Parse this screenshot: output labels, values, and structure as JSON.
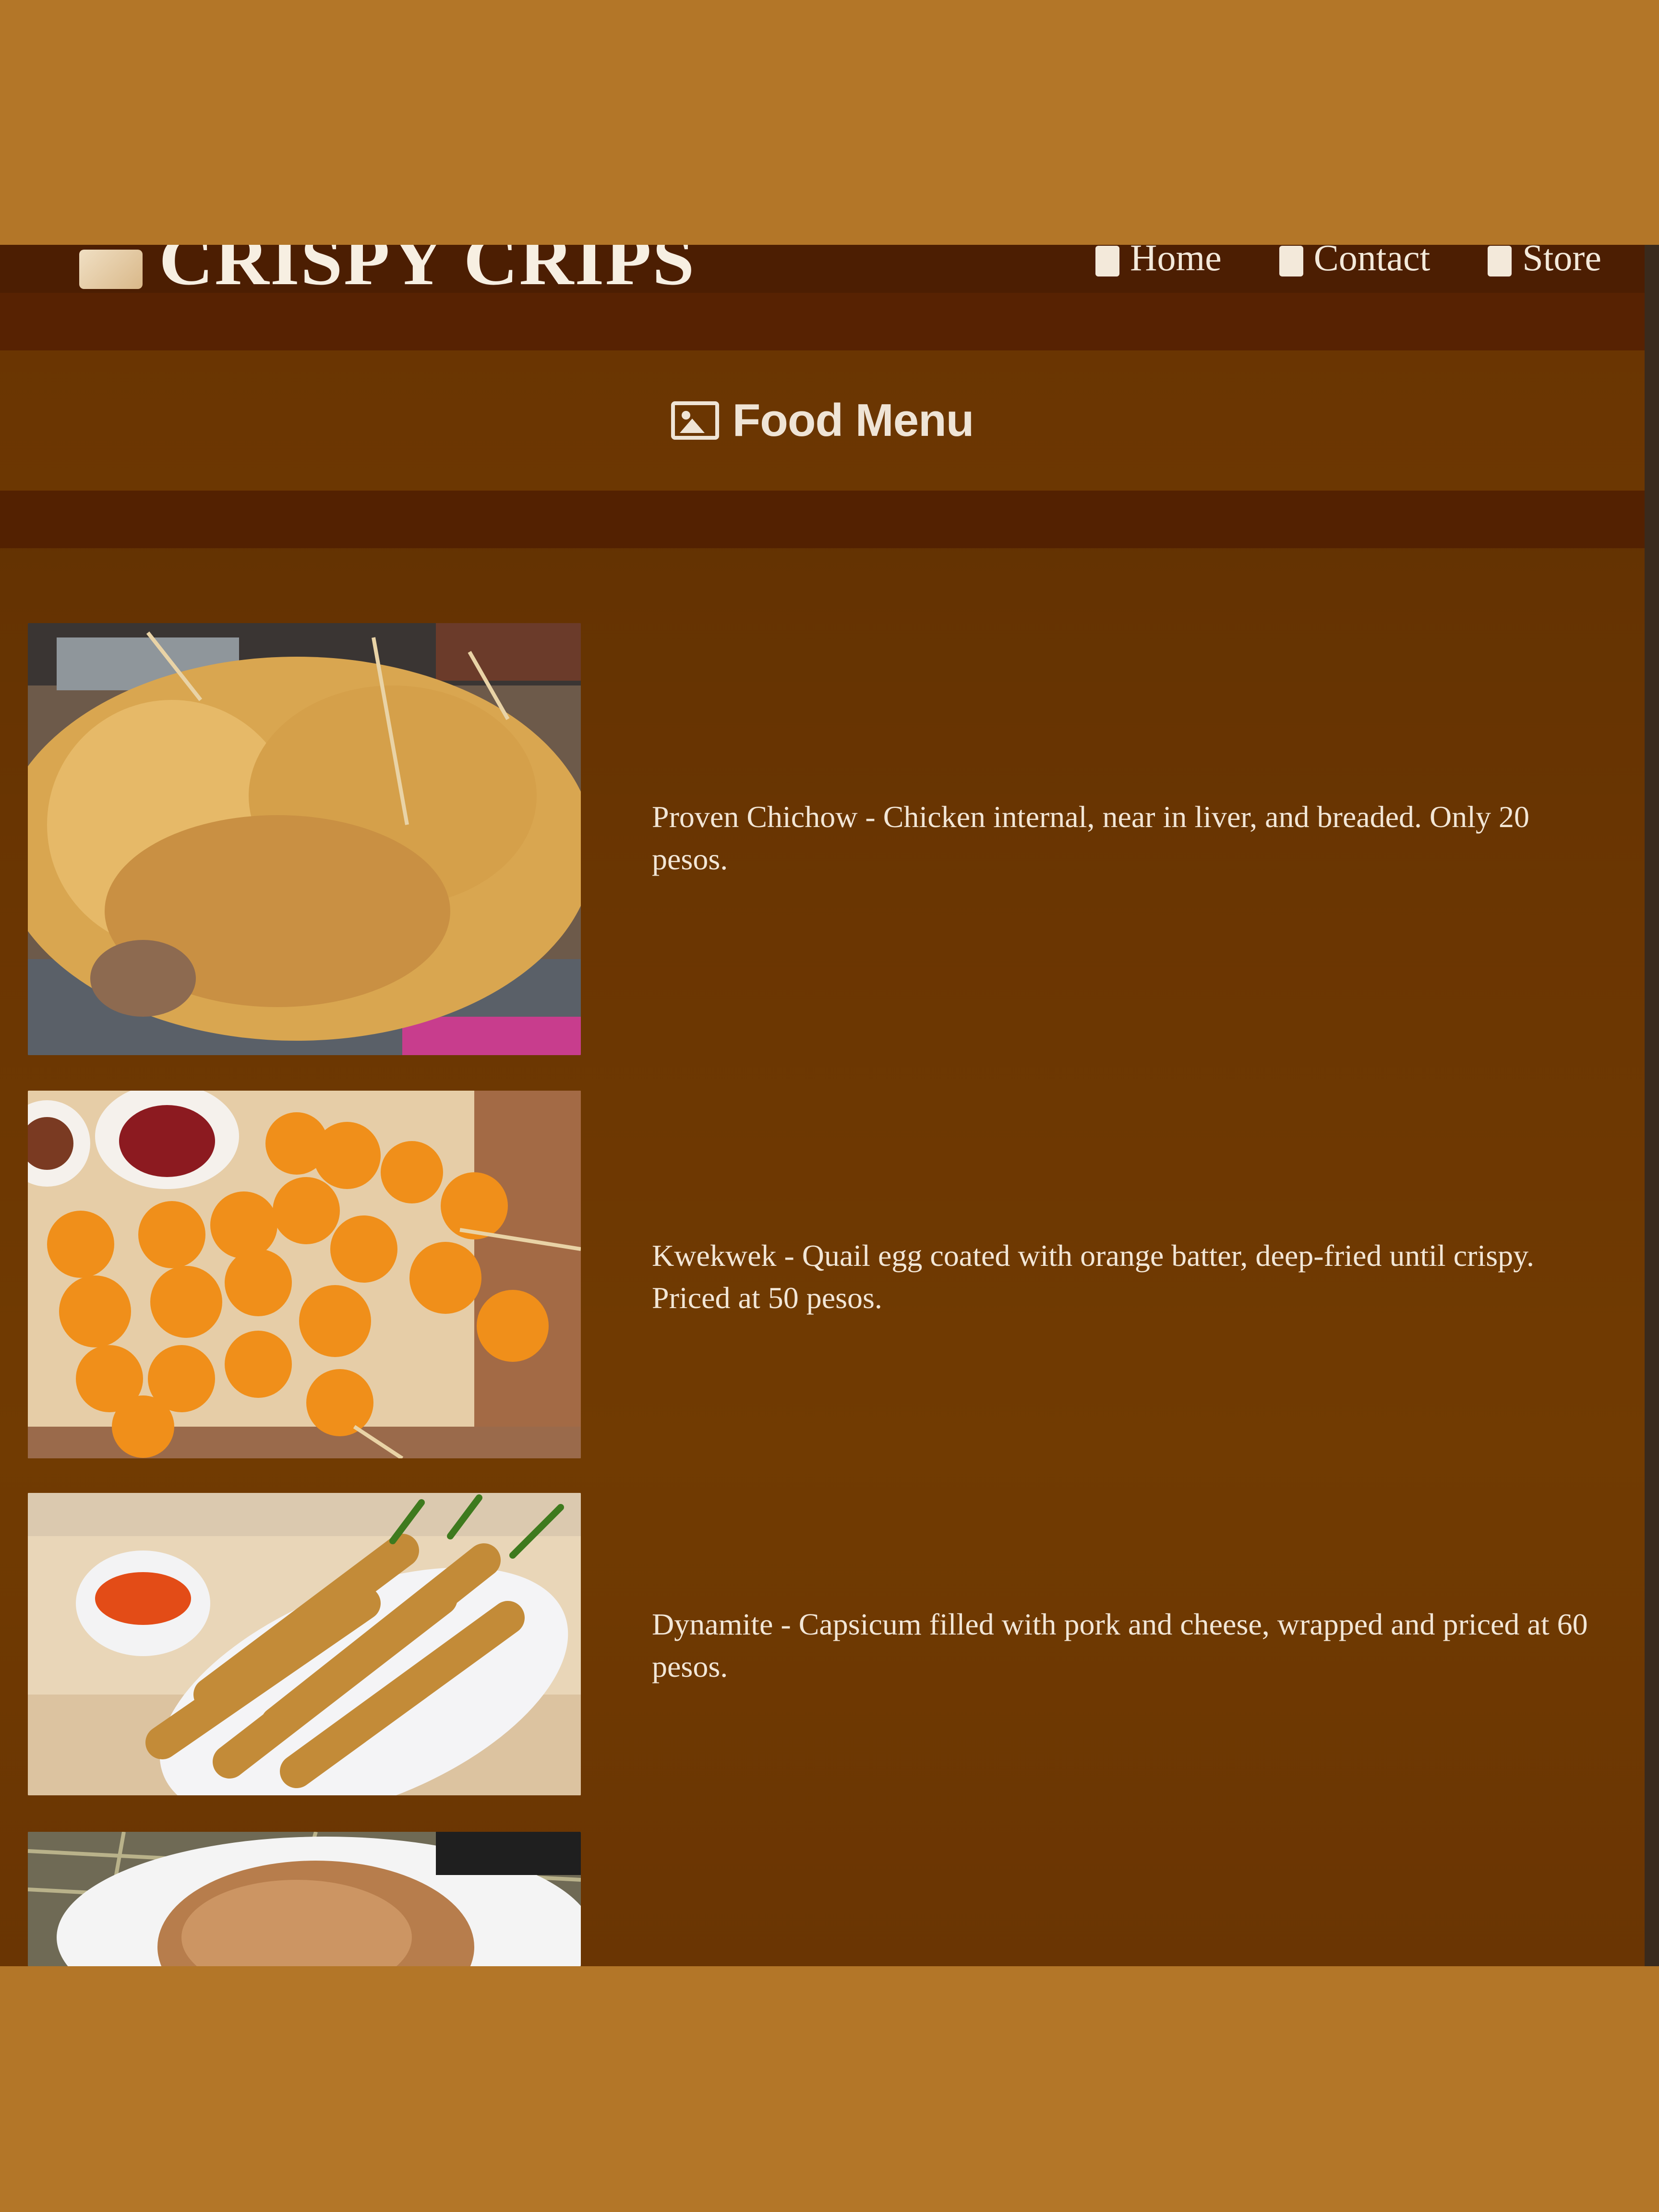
{
  "header": {
    "brand_name": "CRISPY CRIPS",
    "nav": [
      {
        "label": "Home",
        "icon": "home-icon"
      },
      {
        "label": "Contact",
        "icon": "contact-icon"
      },
      {
        "label": "Store",
        "icon": "store-icon"
      }
    ]
  },
  "section": {
    "title": "Food Menu",
    "icon": "image-icon"
  },
  "menu_items": [
    {
      "description": "Proven Chichow - Chicken internal, near in liver, and breaded. Only 20 pesos."
    },
    {
      "description": "Kwekwek - Quail egg coated with orange batter, deep-fried until crispy. Priced at 50 pesos."
    },
    {
      "description": "Dynamite - Capsicum filled with pork and cheese, wrapped and priced at 60 pesos."
    },
    {
      "description": ""
    }
  ]
}
